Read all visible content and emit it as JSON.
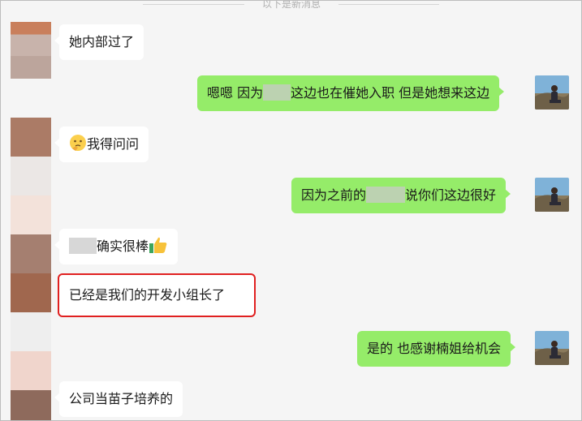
{
  "chat": {
    "divider_text": "以下是新消息",
    "messages": [
      {
        "id": "m1",
        "side": "left",
        "text": "她内部过了"
      },
      {
        "id": "m2",
        "side": "right",
        "pre": "嗯嗯 因为",
        "post": "这边也在催她入职 但是她想来这边"
      },
      {
        "id": "m3",
        "side": "left",
        "emoji": "thinking-face-icon",
        "text": "我得问问"
      },
      {
        "id": "m4",
        "side": "right",
        "pre": "因为之前的",
        "post": "说你们这边很好"
      },
      {
        "id": "m5",
        "side": "left",
        "text": "确实很棒",
        "emoji": "thumbs-up-icon"
      },
      {
        "id": "m6",
        "side": "left",
        "text": "已经是我们的开发小组长了",
        "highlighted": true
      },
      {
        "id": "m7",
        "side": "right",
        "text": "是的 也感谢楠姐给机会"
      },
      {
        "id": "m8",
        "side": "left",
        "text": "公司当苗子培养的"
      }
    ]
  },
  "colors": {
    "sent_bubble": "#95ec69",
    "received_bubble": "#ffffff",
    "highlight_border": "#e02020",
    "background": "#f5f5f5"
  }
}
